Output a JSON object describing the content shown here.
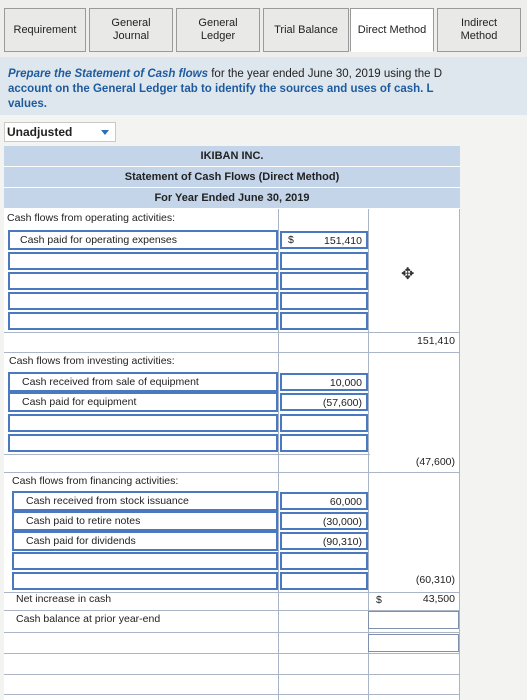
{
  "tabs": [
    {
      "label": "Requirement"
    },
    {
      "label": "General\nJournal"
    },
    {
      "label": "General\nLedger"
    },
    {
      "label": "Trial Balance"
    },
    {
      "label": "Direct Method"
    },
    {
      "label": "Indirect\nMethod"
    }
  ],
  "instruction": {
    "bold_start": "Prepare the Statement of Cash flows",
    "normal": " for the year ended June 30, 2019 using the D",
    "line2": "account on the General Ledger tab to identify the sources and uses of cash. L",
    "line3": "values."
  },
  "dropdown": {
    "selected": "Unadjusted"
  },
  "statement": {
    "company": "IKIBAN INC.",
    "title": "Statement of Cash Flows (Direct Method)",
    "period": "For Year Ended June 30, 2019",
    "operating_header": "Cash flows from operating activities:",
    "operating_items": [
      {
        "label": "Cash paid for operating expenses",
        "dollar": "$",
        "amount": "151,410"
      }
    ],
    "operating_total": {
      "dollar": "$",
      "amount": "151,410"
    },
    "investing_header": "Cash flows from investing activities:",
    "investing_items": [
      {
        "label": "Cash received from sale of equipment",
        "amount": "10,000"
      },
      {
        "label": "Cash paid for equipment",
        "amount": "(57,600)"
      }
    ],
    "investing_total": "(47,600)",
    "financing_header": "Cash flows from financing activities:",
    "financing_items": [
      {
        "label": "Cash received from stock issuance",
        "amount": "60,000"
      },
      {
        "label": "Cash paid to retire notes",
        "amount": "(30,000)"
      },
      {
        "label": "Cash paid for dividends",
        "amount": "(90,310)"
      }
    ],
    "financing_total": "(60,310)",
    "net_increase": {
      "label": "Net increase in cash",
      "dollar": "$",
      "amount": "43,500"
    },
    "prior_balance": {
      "label": "Cash balance at prior year-end"
    }
  }
}
